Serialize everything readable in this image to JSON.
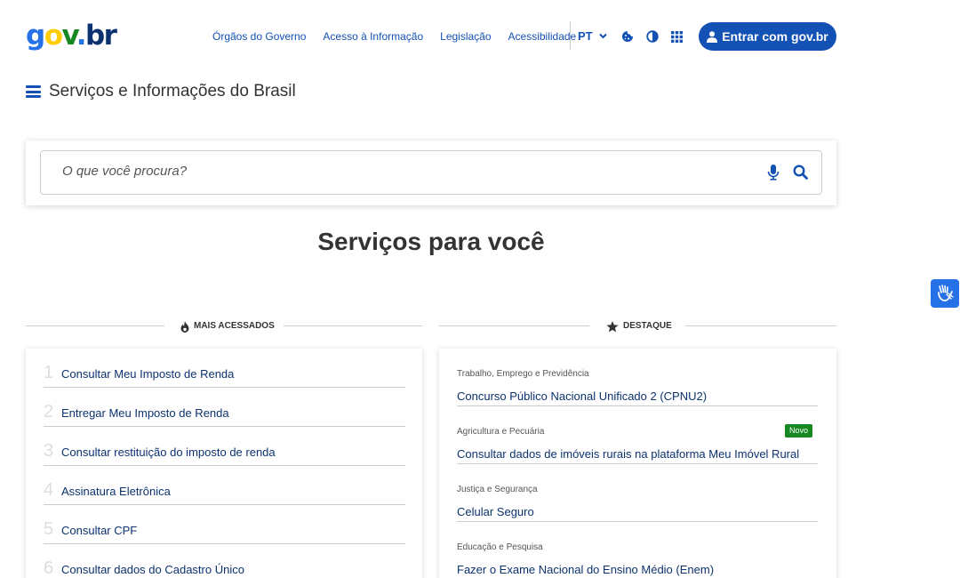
{
  "header": {
    "logo": {
      "g": "g",
      "o": "o",
      "v": "v",
      "dot": ".",
      "br": "br"
    },
    "nav": [
      "Órgãos do Governo",
      "Acesso à Informação",
      "Legislação",
      "Acessibilidade"
    ],
    "language": "PT",
    "login_button": "Entrar com gov.br",
    "brand_color": "#1351b4"
  },
  "page": {
    "title": "Serviços e Informações do Brasil"
  },
  "search": {
    "placeholder": "O que você procura?"
  },
  "services": {
    "title": "Serviços para você",
    "mais_acessados": {
      "label": "MAIS ACESSADOS",
      "items": [
        {
          "num": "1",
          "label": "Consultar Meu Imposto de Renda"
        },
        {
          "num": "2",
          "label": "Entregar Meu Imposto de Renda"
        },
        {
          "num": "3",
          "label": "Consultar restituição do imposto de renda"
        },
        {
          "num": "4",
          "label": "Assinatura Eletrônica"
        },
        {
          "num": "5",
          "label": "Consultar CPF"
        },
        {
          "num": "6",
          "label": "Consultar dados do Cadastro Único"
        }
      ]
    },
    "destaque": {
      "label": "DESTAQUE",
      "items": [
        {
          "category": "Trabalho, Emprego e Previdência",
          "label": "Concurso Público Nacional Unificado 2 (CPNU2)"
        },
        {
          "category": "Agricultura e Pecuária",
          "label": "Consultar dados de imóveis rurais na plataforma Meu Imóvel Rural",
          "badge": "Novo"
        },
        {
          "category": "Justiça e Segurança",
          "label": "Celular Seguro"
        },
        {
          "category": "Educação e Pesquisa",
          "label": "Fazer o Exame Nacional do Ensino Médio (Enem)"
        }
      ]
    }
  }
}
